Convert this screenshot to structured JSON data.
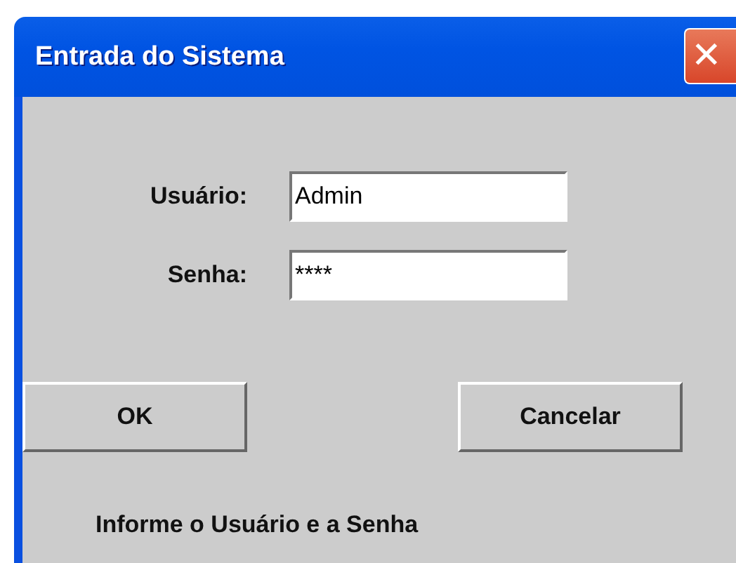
{
  "window": {
    "title": "Entrada do Sistema",
    "close_icon": "✕"
  },
  "fields": [
    {
      "label": "Usuário:",
      "value": "Admin"
    },
    {
      "label": "Senha:",
      "value": "****"
    }
  ],
  "buttons": [
    "OK",
    "Cancelar"
  ],
  "status": "Informe o Usuário e a Senha"
}
